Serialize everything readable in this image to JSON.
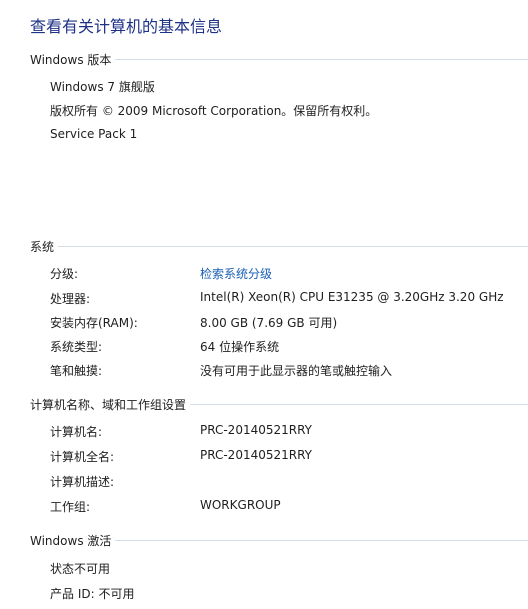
{
  "page_title": "查看有关计算机的基本信息",
  "windows_edition": {
    "header": "Windows 版本",
    "edition": "Windows 7 旗舰版",
    "copyright": "版权所有 © 2009 Microsoft Corporation。保留所有权利。",
    "service_pack": "Service Pack 1"
  },
  "system": {
    "header": "系统",
    "rows": [
      {
        "label": "分级:",
        "value": "检索系统分级"
      },
      {
        "label": "处理器:",
        "value": "Intel(R) Xeon(R) CPU E31235 @ 3.20GHz   3.20 GHz"
      },
      {
        "label": "安装内存(RAM):",
        "value": "8.00 GB (7.69 GB 可用)"
      },
      {
        "label": "系统类型:",
        "value": "64 位操作系统"
      },
      {
        "label": "笔和触摸:",
        "value": "没有可用于此显示器的笔或触控输入"
      }
    ]
  },
  "computer_name": {
    "header": "计算机名称、域和工作组设置",
    "rows": [
      {
        "label": "计算机名:",
        "value": "PRC-20140521RRY"
      },
      {
        "label": "计算机全名:",
        "value": "PRC-20140521RRY"
      },
      {
        "label": "计算机描述:",
        "value": ""
      },
      {
        "label": "工作组:",
        "value": "WORKGROUP"
      }
    ]
  },
  "activation": {
    "header": "Windows 激活",
    "status": "状态不可用",
    "product_id": "产品 ID: 不可用"
  },
  "colors": {
    "title": "#1e3287",
    "link": "#1a5fb4",
    "rule": "#d5dfe5"
  }
}
